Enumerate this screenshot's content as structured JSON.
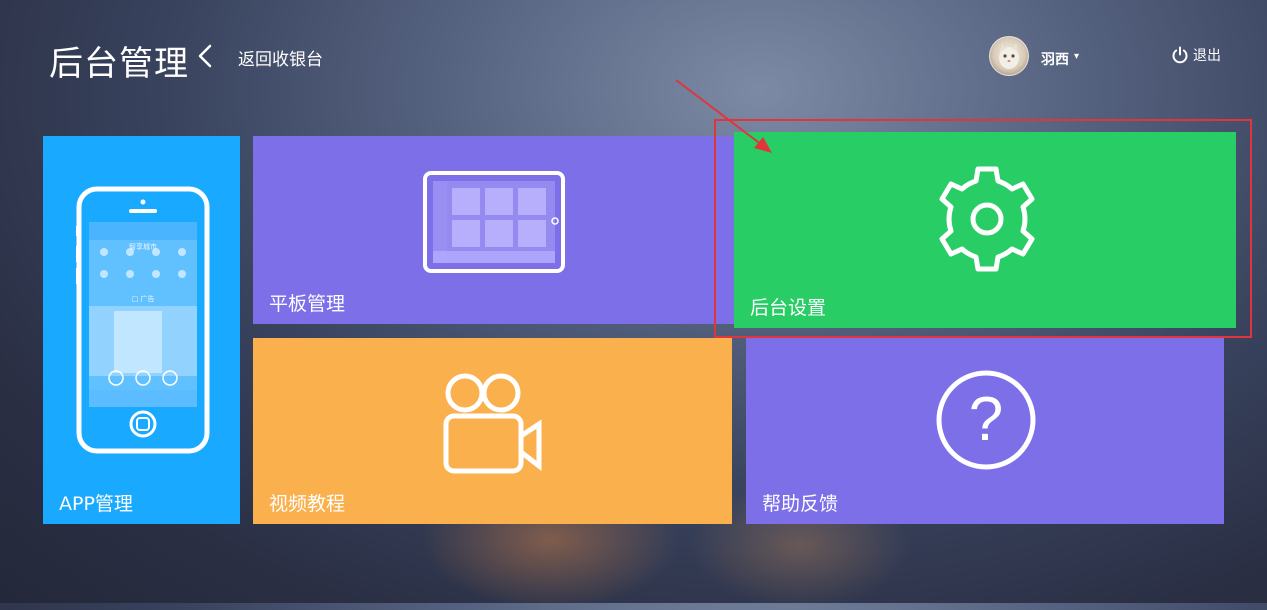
{
  "header": {
    "title": "后台管理",
    "back_label": "返回收银台",
    "user_name": "羽西",
    "logout_label": "退出"
  },
  "tiles": [
    {
      "label": "APP管理",
      "icon": "phone-icon",
      "color": "#19a9ff"
    },
    {
      "label": "平板管理",
      "icon": "tablet-icon",
      "color": "#7c6fe8"
    },
    {
      "label": "后台设置",
      "icon": "gear-icon",
      "color": "#29cd66"
    },
    {
      "label": "视频教程",
      "icon": "video-camera-icon",
      "color": "#fbb04e"
    },
    {
      "label": "帮助反馈",
      "icon": "help-icon",
      "color": "#7c6fe8"
    }
  ],
  "phone_screen": {
    "app_name": "智享城市",
    "center_label": "□ 广告"
  },
  "annotation": {
    "highlight_color": "#e0363b"
  }
}
